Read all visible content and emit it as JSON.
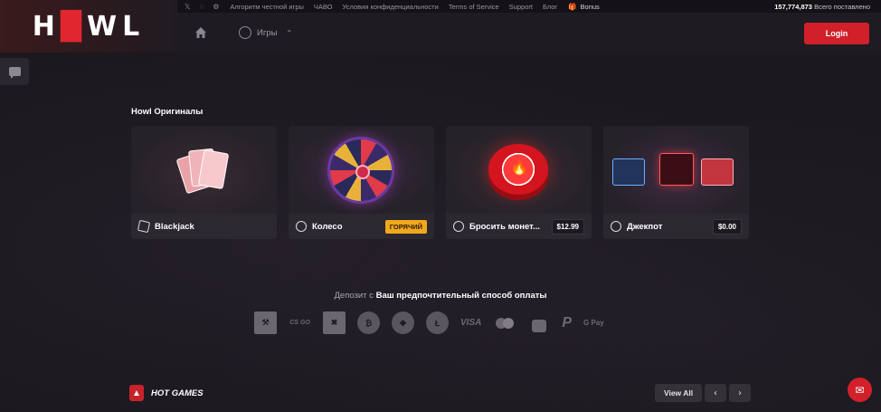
{
  "brand": {
    "logo_text_a": "H",
    "logo_text_b": "WL"
  },
  "topbar": {
    "social_icons": [
      "x-icon",
      "discord-icon",
      "steam-icon"
    ],
    "links": [
      "Алгоритм честной игры",
      "ЧАВО",
      "Условия конфиденциальности",
      "Terms of Service",
      "Support",
      "Блог"
    ],
    "bonus_label": "Bonus",
    "stats_value": "157,774,873",
    "stats_label": "Всего поставлено"
  },
  "navbar": {
    "games_label": "Игры",
    "login_label": "Login"
  },
  "originals": {
    "title": "Howl Оригиналы",
    "cards": [
      {
        "name": "Blackjack",
        "badge": ""
      },
      {
        "name": "Колесо",
        "badge": "ГОРЯЧИЙ"
      },
      {
        "name": "Бросить монет...",
        "badge": "$12.99"
      },
      {
        "name": "Джекпот",
        "badge": "$0.00"
      }
    ]
  },
  "payment": {
    "prefix": "Депозит с",
    "bold": "Ваш предпочтительный способ оплаты",
    "methods": [
      "rust-icon",
      "CS GO",
      "dota-icon",
      "bitcoin-icon",
      "ethereum-icon",
      "litecoin-icon",
      "VISA",
      "mastercard-icon",
      "lock-icon",
      "paypal-icon",
      "G Pay"
    ]
  },
  "hot_games": {
    "title": "HOT GAMES",
    "view_all": "View All"
  },
  "colors": {
    "accent": "#d2202a",
    "hot": "#f0a81c",
    "bg": "#1b181e"
  }
}
